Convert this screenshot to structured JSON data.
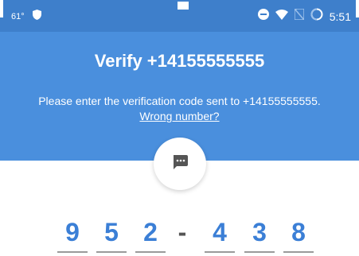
{
  "status_bar": {
    "temperature": "61°",
    "time": "5:51",
    "icons": [
      "shield-icon",
      "do-not-disturb-icon",
      "wifi-icon",
      "no-sim-icon",
      "battery-icon"
    ]
  },
  "header": {
    "title": "Verify +14155555555",
    "instruction": "Please enter the verification code sent to +14155555555.",
    "wrong_number_link": "Wrong number?"
  },
  "sms_icon": "message-icon",
  "code": {
    "digits": [
      "9",
      "5",
      "2",
      "4",
      "3",
      "8"
    ],
    "separator": "-"
  },
  "colors": {
    "header": "#4a8fdd",
    "status_bar": "#3e7fcb",
    "digit": "#3b7fd6"
  }
}
